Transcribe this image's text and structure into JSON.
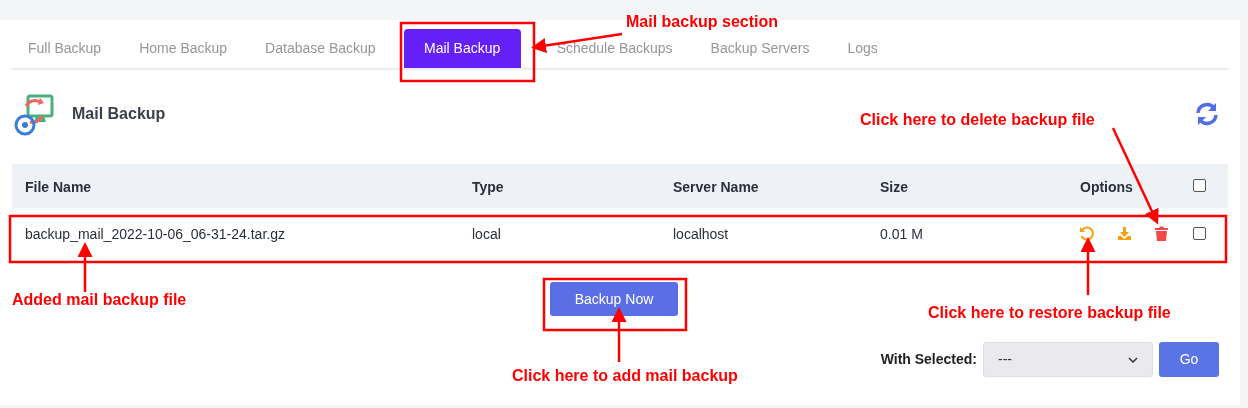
{
  "tabs": [
    {
      "label": "Full Backup",
      "selected": false
    },
    {
      "label": "Home Backup",
      "selected": false
    },
    {
      "label": "Database Backup",
      "selected": false
    },
    {
      "label": "Mail Backup",
      "selected": true
    },
    {
      "label": "Schedule Backups",
      "selected": false
    },
    {
      "label": "Backup Servers",
      "selected": false
    },
    {
      "label": "Logs",
      "selected": false
    }
  ],
  "section": {
    "title": "Mail Backup"
  },
  "table": {
    "columns": [
      "File Name",
      "Type",
      "Server Name",
      "Size",
      "Options"
    ],
    "select_all_checked": false,
    "rows": [
      {
        "cells": [
          "backup_mail_2022-10-06_06-31-24.tar.gz",
          "local",
          "localhost",
          "0.01 M"
        ],
        "checked": false
      }
    ]
  },
  "backup_button": "Backup Now",
  "bulk": {
    "label": "With Selected:",
    "value": "---",
    "go": "Go"
  },
  "annotations": [
    {
      "text": "Mail backup section"
    },
    {
      "text": "Click here to delete backup file"
    },
    {
      "text": "Added mail backup file"
    },
    {
      "text": "Click here to restore backup file"
    },
    {
      "text": "Click here to add mail backup"
    }
  ]
}
